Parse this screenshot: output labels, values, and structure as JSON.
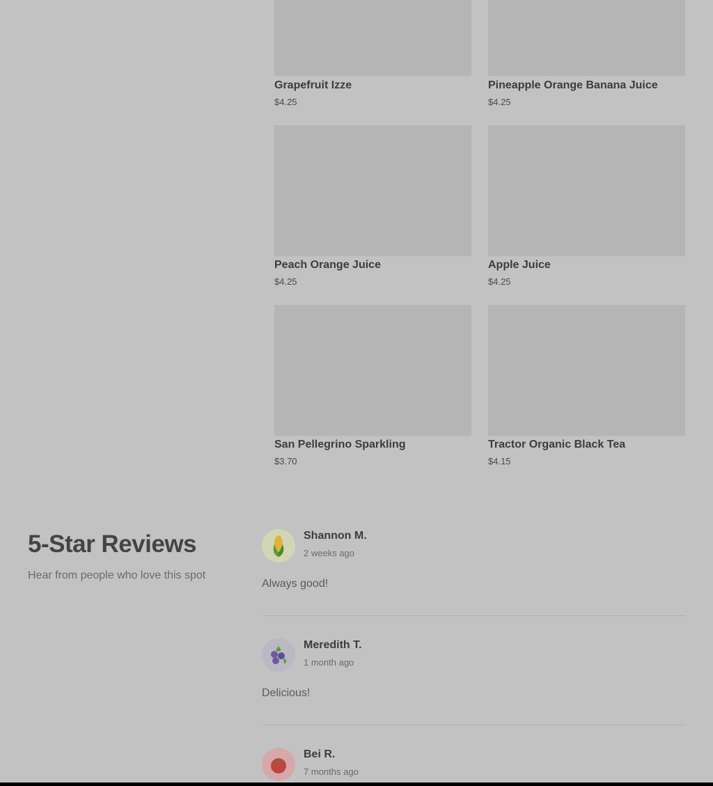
{
  "products": [
    {
      "name": "Grapefruit Izze",
      "price": "$4.25"
    },
    {
      "name": "Pineapple Orange Banana Juice",
      "price": "$4.25"
    },
    {
      "name": "Peach Orange Juice",
      "price": "$4.25"
    },
    {
      "name": "Apple Juice",
      "price": "$4.25"
    },
    {
      "name": "San Pellegrino Sparkling",
      "price": "$3.70"
    },
    {
      "name": "Tractor Organic Black Tea",
      "price": "$4.15"
    }
  ],
  "reviews_section": {
    "title": "5-Star Reviews",
    "subtitle": "Hear from people who love this spot"
  },
  "reviews": [
    {
      "name": "Shannon M.",
      "time": "2 weeks ago",
      "text": "Always good!",
      "avatar_icon": "corn-icon"
    },
    {
      "name": "Meredith T.",
      "time": "1 month ago",
      "text": "Delicious!",
      "avatar_icon": "blueberries-icon"
    },
    {
      "name": "Bei R.",
      "time": "7 months ago",
      "text": "",
      "avatar_icon": "tomato-icon"
    }
  ],
  "colors": {
    "background": "#c2c2c2",
    "image_placeholder": "#b5b5b5"
  }
}
